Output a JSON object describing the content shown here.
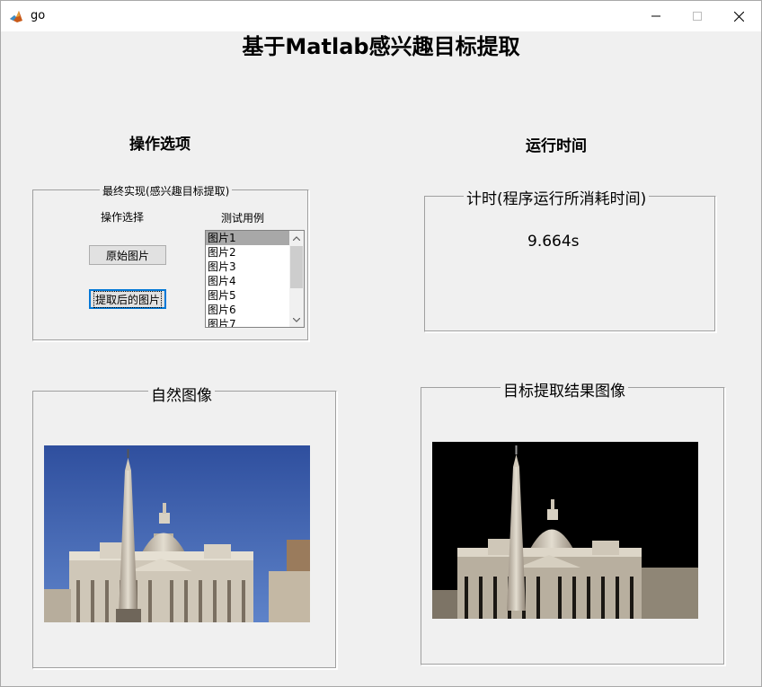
{
  "window": {
    "title": "go",
    "minimize_glyph": "—",
    "maximize_glyph": "☐",
    "close_glyph": "✕",
    "app_icon": "matlab-icon"
  },
  "header": {
    "title": "基于Matlab感兴趣目标提取"
  },
  "sections": {
    "options_title": "操作选项",
    "runtime_title": "运行时间"
  },
  "control_panel": {
    "legend": "最终实现(感兴趣目标提取)",
    "operation_label": "操作选择",
    "testcase_label": "测试用例",
    "original_button": "原始图片",
    "extracted_button": "提取后的图片",
    "listbox": {
      "items": [
        "图片1",
        "图片2",
        "图片3",
        "图片4",
        "图片5",
        "图片6",
        "图片7"
      ],
      "selected": "图片1"
    }
  },
  "timer_panel": {
    "legend": "计时(程序运行所消耗时间)",
    "value": "9.664s"
  },
  "natural_panel": {
    "legend": "自然图像"
  },
  "result_panel": {
    "legend": "目标提取结果图像"
  },
  "colors": {
    "sky": "#3a5fb0",
    "background": "#f0f0f0",
    "result_bg": "#000000"
  }
}
